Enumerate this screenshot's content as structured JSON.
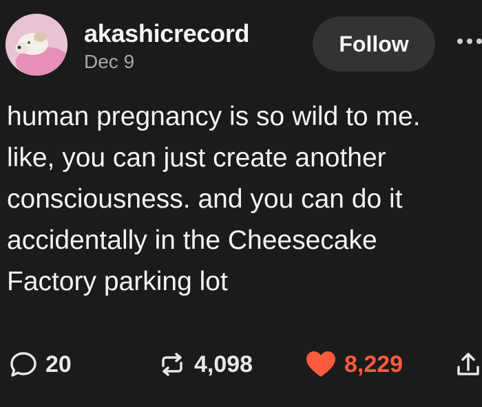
{
  "post": {
    "author": {
      "username": "akashicrecord",
      "date": "Dec 9",
      "avatar_icon": "dog-avatar-icon"
    },
    "follow_label": "Follow",
    "more_icon": "more-dots-icon",
    "text_lines": [
      "human pregnancy is so wild to me.",
      "like, you can just create another",
      "consciousness. and you can do it",
      "accidentally in the Cheesecake",
      "Factory parking lot"
    ],
    "stats": {
      "replies": "20",
      "reblogs": "4,098",
      "likes": "8,229"
    },
    "icons": {
      "reply": "reply-icon",
      "reblog": "reblog-icon",
      "like": "heart-icon",
      "share": "share-icon"
    },
    "colors": {
      "background": "#1b1b1b",
      "like_accent": "#ff5a3c",
      "button_bg": "#333333"
    }
  }
}
